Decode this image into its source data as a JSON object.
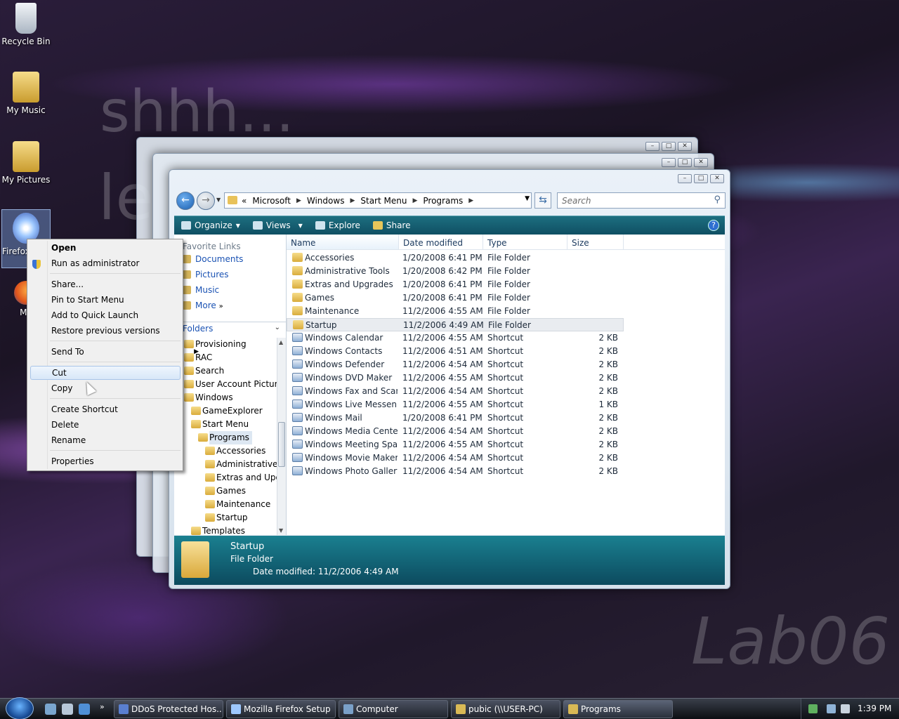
{
  "desktop": {
    "icons": [
      {
        "label": "Recycle Bin"
      },
      {
        "label": "My Music"
      },
      {
        "label": "My Pictures"
      },
      {
        "label": "Firefox"
      },
      {
        "label": "Mo"
      }
    ],
    "watermarks": [
      "shhh...",
      "le",
      "Lab06"
    ]
  },
  "explorer": {
    "address_parts": [
      "Microsoft",
      "Windows",
      "Start Menu",
      "Programs"
    ],
    "address_prefix": "«",
    "search_placeholder": "Search",
    "toolbar": {
      "organize": "Organize",
      "views": "Views",
      "explore": "Explore",
      "share": "Share"
    },
    "nav": {
      "favorite_header": "Favorite Links",
      "links": [
        "Documents",
        "Pictures",
        "Music",
        "More"
      ],
      "folders_header": "Folders",
      "tree": [
        {
          "label": "Provisioning",
          "level": 0
        },
        {
          "label": "RAC",
          "level": 0
        },
        {
          "label": "Search",
          "level": 0
        },
        {
          "label": "User Account Pictures",
          "level": 0
        },
        {
          "label": "Windows",
          "level": 0
        },
        {
          "label": "GameExplorer",
          "level": 1
        },
        {
          "label": "Start Menu",
          "level": 1
        },
        {
          "label": "Programs",
          "level": 2,
          "selected": true
        },
        {
          "label": "Accessories",
          "level": 3
        },
        {
          "label": "Administrative",
          "level": 3
        },
        {
          "label": "Extras and Upg",
          "level": 3
        },
        {
          "label": "Games",
          "level": 3
        },
        {
          "label": "Maintenance",
          "level": 3
        },
        {
          "label": "Startup",
          "level": 3
        },
        {
          "label": "Templates",
          "level": 1
        }
      ]
    },
    "columns": [
      "Name",
      "Date modified",
      "Type",
      "Size"
    ],
    "rows": [
      {
        "name": "Accessories",
        "date": "1/20/2008 6:41 PM",
        "type": "File Folder",
        "size": "",
        "kind": "folder"
      },
      {
        "name": "Administrative Tools",
        "date": "1/20/2008 6:42 PM",
        "type": "File Folder",
        "size": "",
        "kind": "folder"
      },
      {
        "name": "Extras and Upgrades",
        "date": "1/20/2008 6:41 PM",
        "type": "File Folder",
        "size": "",
        "kind": "folder"
      },
      {
        "name": "Games",
        "date": "1/20/2008 6:41 PM",
        "type": "File Folder",
        "size": "",
        "kind": "folder"
      },
      {
        "name": "Maintenance",
        "date": "11/2/2006 4:55 AM",
        "type": "File Folder",
        "size": "",
        "kind": "folder"
      },
      {
        "name": "Startup",
        "date": "11/2/2006 4:49 AM",
        "type": "File Folder",
        "size": "",
        "kind": "folder",
        "selected": true
      },
      {
        "name": "Windows Calendar",
        "date": "11/2/2006 4:55 AM",
        "type": "Shortcut",
        "size": "2 KB",
        "kind": "shortcut"
      },
      {
        "name": "Windows Contacts",
        "date": "11/2/2006 4:51 AM",
        "type": "Shortcut",
        "size": "2 KB",
        "kind": "shortcut"
      },
      {
        "name": "Windows Defender",
        "date": "11/2/2006 4:54 AM",
        "type": "Shortcut",
        "size": "2 KB",
        "kind": "shortcut"
      },
      {
        "name": "Windows DVD Maker",
        "date": "11/2/2006 4:55 AM",
        "type": "Shortcut",
        "size": "2 KB",
        "kind": "shortcut"
      },
      {
        "name": "Windows Fax and Scan",
        "date": "11/2/2006 4:54 AM",
        "type": "Shortcut",
        "size": "2 KB",
        "kind": "shortcut"
      },
      {
        "name": "Windows Live Messen...",
        "date": "11/2/2006 4:55 AM",
        "type": "Shortcut",
        "size": "1 KB",
        "kind": "shortcut"
      },
      {
        "name": "Windows Mail",
        "date": "1/20/2008 6:41 PM",
        "type": "Shortcut",
        "size": "2 KB",
        "kind": "shortcut"
      },
      {
        "name": "Windows Media Center",
        "date": "11/2/2006 4:54 AM",
        "type": "Shortcut",
        "size": "2 KB",
        "kind": "shortcut"
      },
      {
        "name": "Windows Meeting Space",
        "date": "11/2/2006 4:55 AM",
        "type": "Shortcut",
        "size": "2 KB",
        "kind": "shortcut"
      },
      {
        "name": "Windows Movie Maker",
        "date": "11/2/2006 4:54 AM",
        "type": "Shortcut",
        "size": "2 KB",
        "kind": "shortcut"
      },
      {
        "name": "Windows Photo Gallery",
        "date": "11/2/2006 4:54 AM",
        "type": "Shortcut",
        "size": "2 KB",
        "kind": "shortcut"
      }
    ],
    "details": {
      "name": "Startup",
      "type": "File Folder",
      "date_modified": "Date modified: 11/2/2006 4:49 AM"
    }
  },
  "context_menu": {
    "items": [
      "Open",
      "Run as administrator",
      "Share...",
      "Pin to Start Menu",
      "Add to Quick Launch",
      "Restore previous versions",
      "Send To",
      "Cut",
      "Copy",
      "Create Shortcut",
      "Delete",
      "Rename",
      "Properties"
    ],
    "highlighted": "Cut"
  },
  "taskbar": {
    "buttons": [
      "DDoS Protected Hos...",
      "Mozilla Firefox Setup",
      "Computer",
      "pubic (\\\\USER-PC)",
      "Programs"
    ],
    "clock": "1:39 PM"
  },
  "colors": {
    "toolbar": "#0f4f63",
    "details_pane": "#0c4a5e",
    "link": "#1a52b3"
  }
}
